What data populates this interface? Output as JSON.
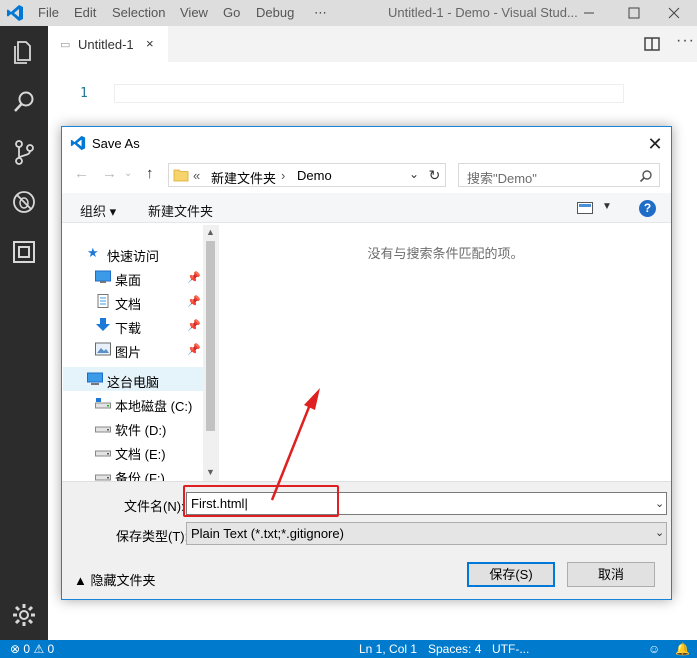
{
  "window": {
    "title": "Untitled-1 - Demo - Visual Stud...",
    "menu": [
      "File",
      "Edit",
      "Selection",
      "View",
      "Go",
      "Debug",
      "⋯"
    ]
  },
  "activity_icons": [
    "files-icon",
    "search-icon",
    "source-control-icon",
    "debug-icon",
    "extensions-icon",
    "settings-gear-icon"
  ],
  "tab": {
    "label": "Untitled-1",
    "close": "×"
  },
  "editor": {
    "line_number": "1"
  },
  "statusbar": {
    "errors": "0",
    "warnings": "0",
    "position": "Ln 1, Col 1",
    "spaces": "Spaces: 4",
    "encoding": "UTF-..."
  },
  "dialog": {
    "title": "Save As",
    "breadcrumb_prefix": "«",
    "breadcrumb": [
      "新建文件夹",
      "Demo"
    ],
    "search_placeholder": "搜索\"Demo\"",
    "toolbar": {
      "organize": "组织 ▾",
      "new_folder": "新建文件夹"
    },
    "nav_items": [
      {
        "label": "快速访问",
        "icon": "star-icon"
      },
      {
        "label": "桌面",
        "icon": "desktop-icon",
        "pinned": true
      },
      {
        "label": "文档",
        "icon": "document-icon",
        "pinned": true
      },
      {
        "label": "下载",
        "icon": "download-icon",
        "pinned": true
      },
      {
        "label": "图片",
        "icon": "pictures-icon",
        "pinned": true
      },
      {
        "label": "这台电脑",
        "icon": "computer-icon",
        "selected": true
      },
      {
        "label": "本地磁盘 (C:)",
        "icon": "drive-icon"
      },
      {
        "label": "软件 (D:)",
        "icon": "drive-icon"
      },
      {
        "label": "文档 (E:)",
        "icon": "drive-icon"
      },
      {
        "label": "备份 (F:)",
        "icon": "drive-icon"
      }
    ],
    "empty_message": "没有与搜索条件匹配的项。",
    "filename_label": "文件名(N):",
    "filename_value": "First.html",
    "filetype_label": "保存类型(T):",
    "filetype_value": "Plain Text (*.txt;*.gitignore)",
    "hide_folders": "▲ 隐藏文件夹",
    "save_button": "保存(S)",
    "cancel_button": "取消"
  },
  "colors": {
    "accent": "#007acc",
    "activity_bar": "#2c2c2c",
    "annotation": "#e02020"
  }
}
